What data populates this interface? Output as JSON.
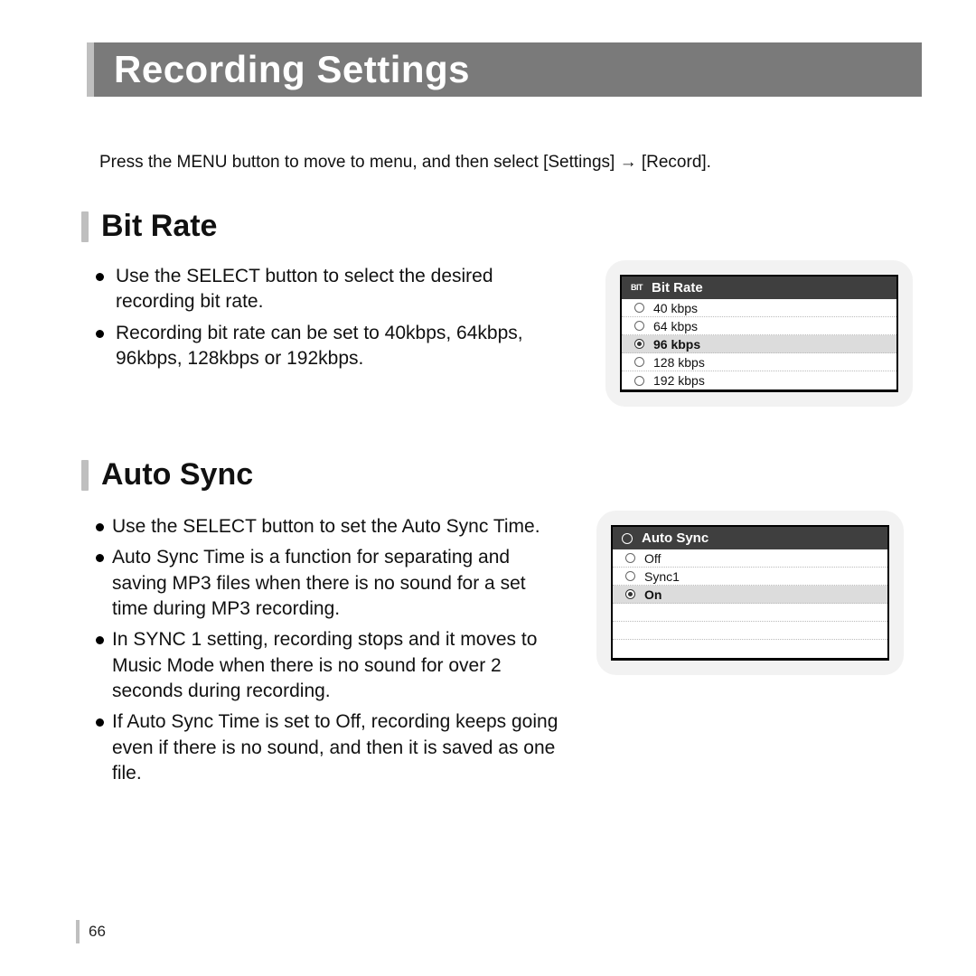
{
  "page_number": "66",
  "title": "Recording Settings",
  "intro": "Press the MENU button to move to menu, and then select [Settings] → [Record].",
  "sections": {
    "bitrate": {
      "heading": "Bit Rate",
      "bullets": [
        "Use the SELECT button to select the desired recording bit rate.",
        "Recording bit rate can be set to 40kbps, 64kbps, 96kbps, 128kbps or 192kbps."
      ],
      "panel": {
        "icon_label": "BIT",
        "title": "Bit Rate",
        "selected_index": 2,
        "options": [
          "40 kbps",
          "64 kbps",
          "96 kbps",
          "128 kbps",
          "192 kbps"
        ]
      }
    },
    "autosync": {
      "heading": "Auto Sync",
      "bullets": [
        "Use the SELECT button to set the Auto Sync Time.",
        "Auto Sync Time is a function for separating and saving MP3 files when there is no sound for a set time during MP3 recording.",
        "In SYNC 1 setting, recording stops and it moves to Music Mode when there is no sound for over 2 seconds during recording.",
        "If Auto Sync Time is set to Off, recording keeps going even if there is no sound, and then it is saved as one file."
      ],
      "panel": {
        "title": "Auto Sync",
        "selected_index": 2,
        "options": [
          "Off",
          "Sync1",
          "On"
        ]
      }
    }
  }
}
